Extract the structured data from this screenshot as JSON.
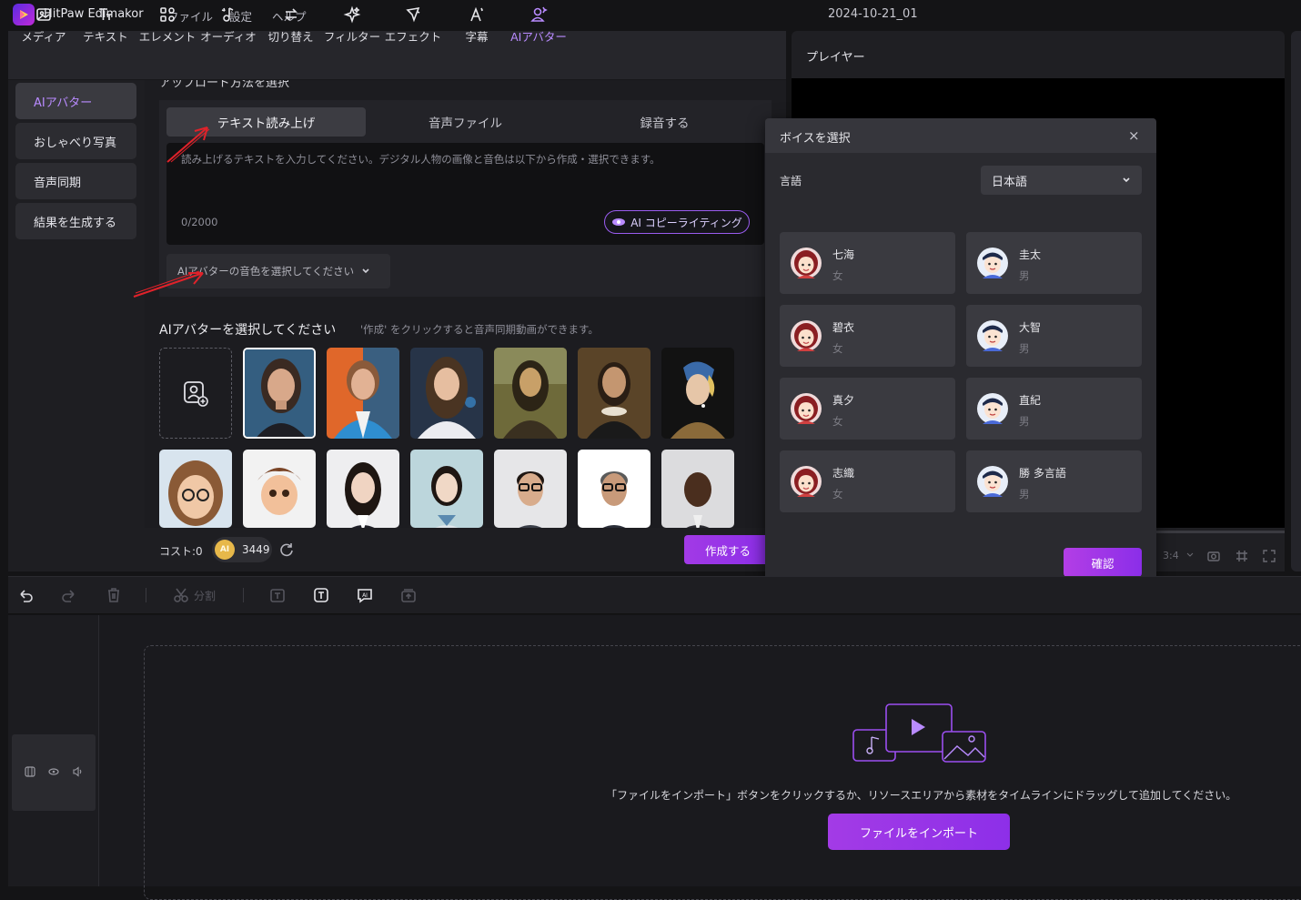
{
  "app": {
    "name": "HitPaw Edimakor",
    "project_title": "2024-10-21_01"
  },
  "menu": [
    "ファイル",
    "設定",
    "ヘルプ"
  ],
  "toolbar": {
    "items": [
      {
        "label": "メディア",
        "icon": "media-icon"
      },
      {
        "label": "テキスト",
        "icon": "text-icon"
      },
      {
        "label": "エレメント",
        "icon": "element-icon"
      },
      {
        "label": "オーディオ",
        "icon": "audio-icon"
      },
      {
        "label": "切り替え",
        "icon": "transition-icon"
      },
      {
        "label": "フィルター",
        "icon": "filter-icon"
      },
      {
        "label": "エフェクト",
        "icon": "effect-icon"
      },
      {
        "label": "字幕",
        "icon": "subtitle-icon"
      },
      {
        "label": "AIアバター",
        "icon": "ai-avatar-icon"
      }
    ],
    "active": "AIアバター"
  },
  "sidenav": {
    "items": [
      "AIアバター",
      "おしゃべり写真",
      "音声同期",
      "結果を生成する"
    ],
    "active": "AIアバター"
  },
  "form": {
    "upload_header": "アップロード方法を選択",
    "tabs": [
      "テキスト読み上げ",
      "音声ファイル",
      "録音する"
    ],
    "active_tab": "テキスト読み上げ",
    "textarea_placeholder": "読み上げるテキストを入力してください。デジタル人物の画像と音色は以下から作成・選択できます。",
    "counter": "0/2000",
    "copywriting_button": "AI コピーライティング",
    "voice_select_placeholder": "AIアバターの音色を選択してください"
  },
  "avatars": {
    "header": "AIアバターを選択してください",
    "hint": "'作成' をクリックすると音声同期動画ができます。"
  },
  "bottom": {
    "cost_label": "コスト:0",
    "credits": "3449",
    "coin_label": "AI",
    "create_button": "作成する"
  },
  "player": {
    "title": "プレイヤー",
    "ratio": "3:4"
  },
  "voice_dialog": {
    "title": "ボイスを選択",
    "close": "×",
    "language_label": "言語",
    "language_value": "日本語",
    "voices": [
      {
        "name": "七海",
        "gender": "女"
      },
      {
        "name": "圭太",
        "gender": "男"
      },
      {
        "name": "碧衣",
        "gender": "女"
      },
      {
        "name": "大智",
        "gender": "男"
      },
      {
        "name": "真夕",
        "gender": "女"
      },
      {
        "name": "直紀",
        "gender": "男"
      },
      {
        "name": "志織",
        "gender": "女"
      },
      {
        "name": "勝 多言語",
        "gender": "男"
      }
    ],
    "confirm": "確認"
  },
  "timeline": {
    "split_label": "分割",
    "drop_text": "「ファイルをインポート」ボタンをクリックするか、リソースエリアから素材をタイムラインにドラッグして追加してください。",
    "import_button": "ファイルをインポート"
  },
  "colors": {
    "accent": "#9b4ef0",
    "annotation_arrow": "#e0222a"
  }
}
